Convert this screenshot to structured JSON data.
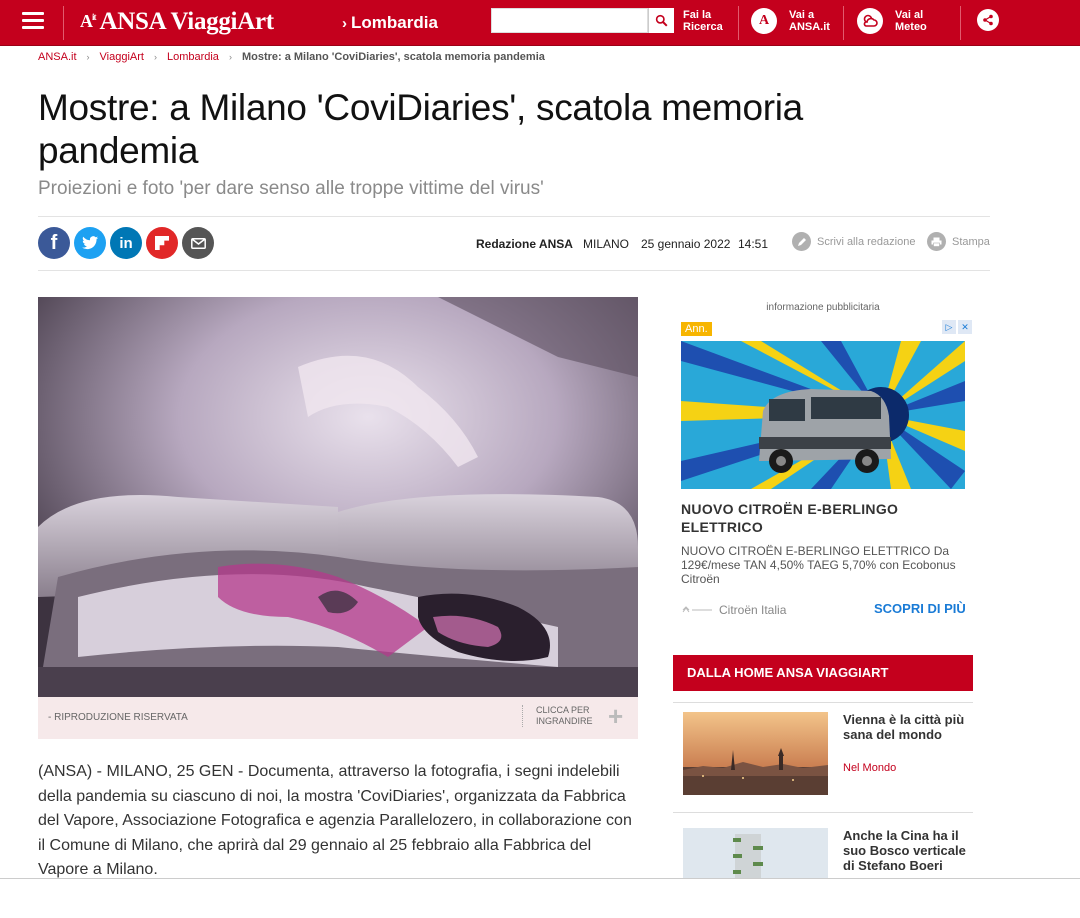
{
  "header": {
    "logo_mark": "A",
    "logo_mark_sup": "it",
    "logo_text": "ANSA ViaggiArt",
    "region": "Lombardia",
    "search": {
      "value": "",
      "placeholder": ""
    },
    "links": [
      {
        "line1": "Fai la",
        "line2": "Ricerca"
      },
      {
        "line1": "Vai a",
        "line2": "ANSA.it"
      },
      {
        "line1": "Vai al",
        "line2": "Meteo"
      }
    ],
    "ansa_badge": "A"
  },
  "breadcrumb": {
    "items": [
      "ANSA.it",
      "ViaggiArt",
      "Lombardia"
    ],
    "current": "Mostre: a Milano 'CoviDiaries', scatola memoria pandemia"
  },
  "article": {
    "title": "Mostre: a Milano 'CoviDiaries', scatola memoria pandemia",
    "subtitle": "Proiezioni e foto 'per dare senso alle troppe vittime del virus'",
    "author": "Redazione ANSA",
    "place": "MILANO",
    "date": "25 gennaio 2022",
    "time": "14:51",
    "write_label": "Scrivi alla redazione",
    "print_label": "Stampa",
    "image_caption": "- RIPRODUZIONE RISERVATA",
    "enlarge_line1": "CLICCA PER",
    "enlarge_line2": "INGRANDIRE",
    "body": "(ANSA) - MILANO, 25 GEN - Documenta, attraverso la fotografia, i segni indelebili della pandemia su ciascuno di noi, la mostra 'CoviDiaries', organizzata da Fabbrica del Vapore, Associazione Fotografica e agenzia Parallelozero, in collaborazione con il Comune di Milano, che aprirà dal 29 gennaio al 25 febbraio alla Fabbrica del Vapore a Milano."
  },
  "social": [
    "facebook-icon",
    "twitter-icon",
    "linkedin-icon",
    "flipboard-icon",
    "email-icon"
  ],
  "social_colors": {
    "facebook": "#3b5998",
    "twitter": "#1da1f2",
    "linkedin": "#0077b5",
    "flipboard": "#e12828",
    "email": "#555555"
  },
  "ad": {
    "label": "informazione pubblicitaria",
    "badge": "Ann.",
    "title": "NUOVO CITROËN E-BERLINGO ELETTRICO",
    "description": "NUOVO CITROËN E-BERLINGO ELETTRICO Da 129€/mese TAN 4,50% TAEG 5,70% con Ecobonus Citroën",
    "brand": "Citroën Italia",
    "cta": "SCOPRI DI PIÙ"
  },
  "sidebar": {
    "section_title": "DALLA HOME ANSA VIAGGIART",
    "news": [
      {
        "title": "Vienna è la città più sana del mondo",
        "category": "Nel Mondo"
      },
      {
        "title": "Anche la Cina ha il suo Bosco verticale di Stefano Boeri",
        "category": ""
      }
    ]
  },
  "colors": {
    "brand": "#c4001d",
    "link_blue": "#1a7bd6"
  }
}
